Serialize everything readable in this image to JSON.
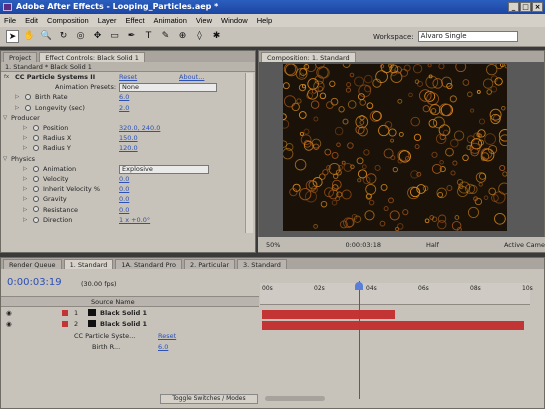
{
  "window": {
    "title": "Adobe After Effects - Looping_Particles.aep *",
    "buttons": [
      "_",
      "□",
      "×"
    ]
  },
  "menu": [
    "File",
    "Edit",
    "Composition",
    "Layer",
    "Effect",
    "Animation",
    "View",
    "Window",
    "Help"
  ],
  "toolbar": {
    "tools": [
      "selection-tool",
      "hand-tool",
      "zoom-tool",
      "rotate-tool",
      "orbit-camera-tool",
      "pan-behind-tool",
      "mask-tool",
      "pen-tool",
      "type-tool",
      "brush-tool",
      "clone-stamp-tool",
      "eraser-tool",
      "puppet-pin-tool"
    ],
    "tool_glyphs": [
      "➤",
      "✋",
      "🔍",
      "↻",
      "◎",
      "✥",
      "▭",
      "✒",
      "T",
      "✎",
      "⊕",
      "◊",
      "✱"
    ],
    "workspace_label": "Workspace:",
    "workspace_value": "Alvaro Single"
  },
  "left_panel": {
    "tabs": [
      "Project",
      "Effect Controls: Black Solid 1"
    ],
    "header": "1. Standard * Black Solid 1",
    "effect_name": "CC Particle Systems II",
    "reset": "Reset",
    "about": "About...",
    "presets_label": "Animation Presets:",
    "presets_value": "None",
    "rows": [
      {
        "label": "Birth Rate",
        "value": "6.0",
        "indent": 1
      },
      {
        "label": "Longevity (sec)",
        "value": "2.0",
        "indent": 1
      },
      {
        "label": "Producer",
        "value": "",
        "indent": 0
      },
      {
        "label": "Position",
        "value": "320.0, 240.0",
        "indent": 2
      },
      {
        "label": "Radius X",
        "value": "150.0",
        "indent": 2
      },
      {
        "label": "Radius Y",
        "value": "120.0",
        "indent": 2
      },
      {
        "label": "Physics",
        "value": "",
        "indent": 0
      },
      {
        "label": "Animation",
        "value": "Explosive",
        "indent": 2,
        "dropdown": true
      },
      {
        "label": "Velocity",
        "value": "0.0",
        "indent": 2
      },
      {
        "label": "Inherit Velocity %",
        "value": "0.0",
        "indent": 2
      },
      {
        "label": "Gravity",
        "value": "0.0",
        "indent": 2
      },
      {
        "label": "Resistance",
        "value": "0.0",
        "indent": 2
      },
      {
        "label": "Direction",
        "value": "1 x +0.0°",
        "indent": 2
      }
    ]
  },
  "comp_panel": {
    "tab": "Composition: 1. Standard",
    "zoom": "50%",
    "timecode": "0:00:03:18",
    "resolution": "Half",
    "camera": "Active Came"
  },
  "timeline": {
    "tabs": [
      "Render Queue",
      "1. Standard",
      "1A. Standard Pro",
      "2. Particular",
      "3. Standard"
    ],
    "timecode": "0:00:03:19",
    "fps": "(30.00 fps)",
    "column_source": "Source Name",
    "layers": [
      {
        "num": "1",
        "name": "Black Solid 1",
        "color": "#c33535"
      },
      {
        "num": "2",
        "name": "Black Solid 1",
        "color": "#c33535"
      }
    ],
    "effect_row": {
      "name": "CC Particle Syste...",
      "reset": "Reset"
    },
    "param_row": {
      "name": "Birth R...",
      "value": "6.0"
    },
    "ruler_labels": [
      "00s",
      "02s",
      "04s",
      "06s",
      "08s",
      "10s"
    ],
    "toggle_label": "Toggle Switches / Modes"
  }
}
